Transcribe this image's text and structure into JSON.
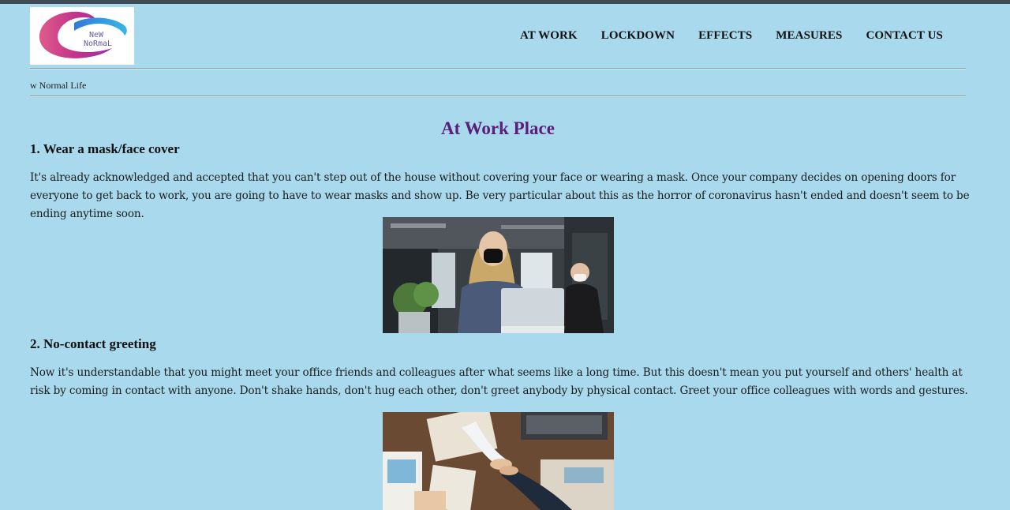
{
  "header": {
    "logo_text_line1": "NeW",
    "logo_text_line2": "NoRmaL",
    "nav": [
      "AT WORK",
      "LOCKDOWN",
      "EFFECTS",
      "MEASURES",
      "CONTACT US"
    ]
  },
  "ticker": {
    "text": "w Normal Life"
  },
  "main": {
    "title": "At Work Place",
    "sections": [
      {
        "heading": "1. Wear a mask/face cover",
        "body": "It's already acknowledged and accepted that you can't step out of the house without covering your face or wearing a mask. Once your company decides on opening doors for everyone to get back to work, you are going to have to wear masks and show up. Be very particular about this as the horror of coronavirus hasn't ended and doesn't seem to be ending anytime soon."
      },
      {
        "heading": "2. No-contact greeting",
        "body": "Now it's understandable that you might meet your office friends and colleagues after what seems like a long time. But this doesn't mean you put yourself and others' health at risk by coming in contact with anyone. Don't shake hands, don't hug each other, don't greet anybody by physical contact. Greet your office colleagues with words and gestures."
      }
    ]
  },
  "colors": {
    "background": "#a9d9ec",
    "title": "#5a1e7a",
    "topbar": "#3f4a55"
  }
}
